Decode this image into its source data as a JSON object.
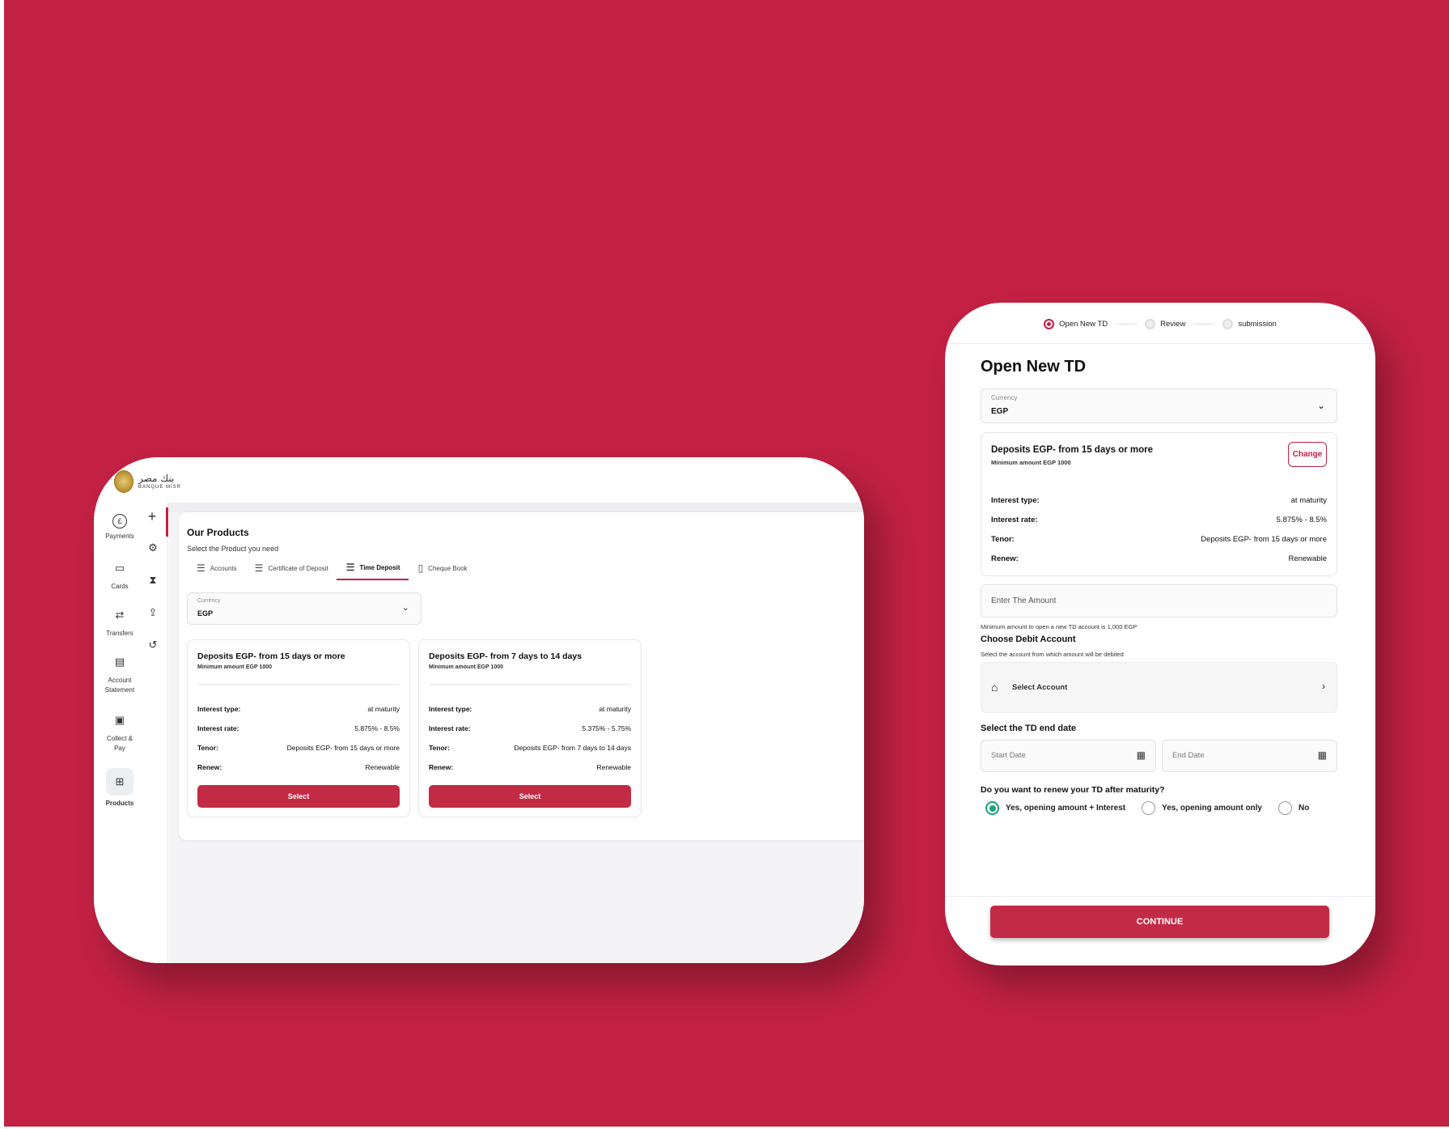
{
  "brand": {
    "arabic": "بنك مصر",
    "english": "BANQUE MISR"
  },
  "sidebar": {
    "items": [
      {
        "label": "Payments",
        "icon": "pound-coin-icon"
      },
      {
        "label": "Cards",
        "icon": "card-icon"
      },
      {
        "label": "Transfers",
        "icon": "transfer-icon"
      },
      {
        "label": "Account Statement",
        "icon": "statement-icon"
      },
      {
        "label": "Collect & Pay",
        "icon": "collect-pay-icon"
      },
      {
        "label": "Products",
        "icon": "products-icon",
        "active": true
      }
    ],
    "add_icon": "+"
  },
  "products": {
    "title": "Our Products",
    "subtitle": "Select the Product you need",
    "tabs": [
      {
        "label": "Accounts"
      },
      {
        "label": "Certificate of Deposit"
      },
      {
        "label": "Time Deposit",
        "active": true
      },
      {
        "label": "Cheque Book"
      }
    ],
    "currency": {
      "label": "Currency",
      "value": "EGP"
    },
    "cards": [
      {
        "title": "Deposits EGP- from 15 days or more",
        "min": "Minimum amount EGP 1000",
        "rows": [
          {
            "k": "Interest type:",
            "v": "at maturity"
          },
          {
            "k": "Interest rate:",
            "v": "5.875% - 8.5%"
          },
          {
            "k": "Tenor:",
            "v": "Deposits EGP- from 15 days or more"
          },
          {
            "k": "Renew:",
            "v": "Renewable"
          }
        ],
        "button": "Select"
      },
      {
        "title": "Deposits EGP- from 7 days to 14 days",
        "min": "Minimum amount EGP 1000",
        "rows": [
          {
            "k": "Interest type:",
            "v": "at maturity"
          },
          {
            "k": "Interest rate:",
            "v": "5.375% - 5.75%"
          },
          {
            "k": "Tenor:",
            "v": "Deposits EGP- from 7 days to 14 days"
          },
          {
            "k": "Renew:",
            "v": "Renewable"
          }
        ],
        "button": "Select"
      }
    ]
  },
  "mobile": {
    "steps": [
      {
        "label": "Open New TD",
        "active": true
      },
      {
        "label": "Review"
      },
      {
        "label": "submission"
      }
    ],
    "title": "Open New TD",
    "currency": {
      "label": "Currency",
      "value": "EGP"
    },
    "product": {
      "title": "Deposits EGP- from 15 days or more",
      "min": "Minimum amount EGP 1000",
      "change": "Change",
      "rows": [
        {
          "k": "Interest type:",
          "v": "at maturity"
        },
        {
          "k": "Interest rate:",
          "v": "5.875% - 8.5%"
        },
        {
          "k": "Tenor:",
          "v": "Deposits EGP- from 15 days or more"
        },
        {
          "k": "Renew:",
          "v": "Renewable"
        }
      ]
    },
    "amount_placeholder": "Enter The Amount",
    "amount_hint": "Minimum amount to open a new TD account is 1,000 EGP",
    "debit": {
      "title": "Choose Debit Account",
      "hint": "Select the account from which amount will be debited",
      "select": "Select Account"
    },
    "dates": {
      "title": "Select the TD end date",
      "start": "Start Date",
      "end": "End Date"
    },
    "renew": {
      "question": "Do you want to renew your TD after maturity?",
      "options": [
        {
          "label": "Yes, opening amount + Interest",
          "selected": true
        },
        {
          "label": "Yes, opening amount only"
        },
        {
          "label": "No"
        }
      ]
    },
    "continue": "CONTINUE"
  },
  "colors": {
    "brand_red": "#c22143",
    "button_red": "#c22b45",
    "radio_green": "#1aa37a"
  }
}
